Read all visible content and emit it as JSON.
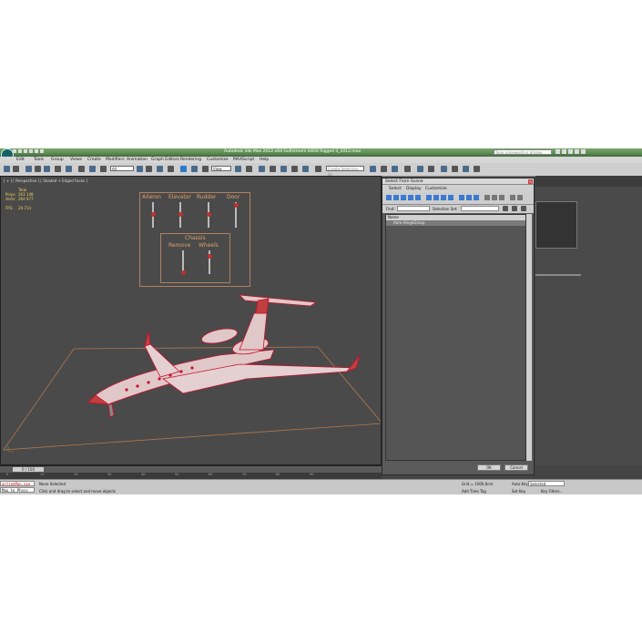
{
  "titlebar": {
    "title": "Autodesk 3ds Max 2012 x64     Gulfstream G650 Rigged 3_2012.max",
    "search_placeholder": "Type a keyword or phrase"
  },
  "menu": [
    "Edit",
    "Tools",
    "Group",
    "Views",
    "Create",
    "Modifiers",
    "Animation",
    "Graph Editors",
    "Rendering",
    "Customize",
    "MAXScript",
    "Help"
  ],
  "toolbar": {
    "filter_value": "All",
    "view_value": "View",
    "selection_set_placeholder": "Create Selection Se"
  },
  "viewport": {
    "label": "[ + ] [ Perspective ] [ Shaded + Edged Faces ]",
    "stats": {
      "total_label": "Total",
      "polys_label": "Polys:",
      "polys_value": "263 148",
      "verts_label": "Verts:",
      "verts_value": "264 977",
      "fps_label": "FPS:",
      "fps_value": "29.714"
    },
    "controls": {
      "aileron": "Aileron",
      "elevator": "Elevator",
      "rudder": "Rudder",
      "door": "Door",
      "chassis": "Chassis",
      "remove": "Remove",
      "wheels": "Wheels"
    },
    "colors": {
      "wireframe": "#c8102e",
      "grid": "#b07a50",
      "label": "#e0a070",
      "stats": "#e8d060"
    }
  },
  "timeline": {
    "thumb": "0 / 100",
    "ticks": [
      "0",
      "10",
      "20",
      "30",
      "40",
      "50",
      "60",
      "70",
      "80",
      "90"
    ]
  },
  "statusbar": {
    "maxscript_line1": "actionMan.exe",
    "maxscript_line2": "Max to Physc",
    "selection": "None Selected",
    "prompt": "Click and drag to select and move objects",
    "grid": "Grid = 1000,0cm",
    "autokey": "Auto Key",
    "selected": "Selected",
    "set_key": "Set Key",
    "key_filters": "Key Filters...",
    "add_time_tag": "Add Time Tag"
  },
  "dialog": {
    "title": "Select From Scene",
    "menu": [
      "Select",
      "Display",
      "Customize"
    ],
    "find_label": "Find:",
    "selection_set_label": "Selection Set:",
    "column_name": "Name",
    "items": [
      "Aero-HingeGroup"
    ],
    "ok": "OK",
    "cancel": "Cancel"
  }
}
